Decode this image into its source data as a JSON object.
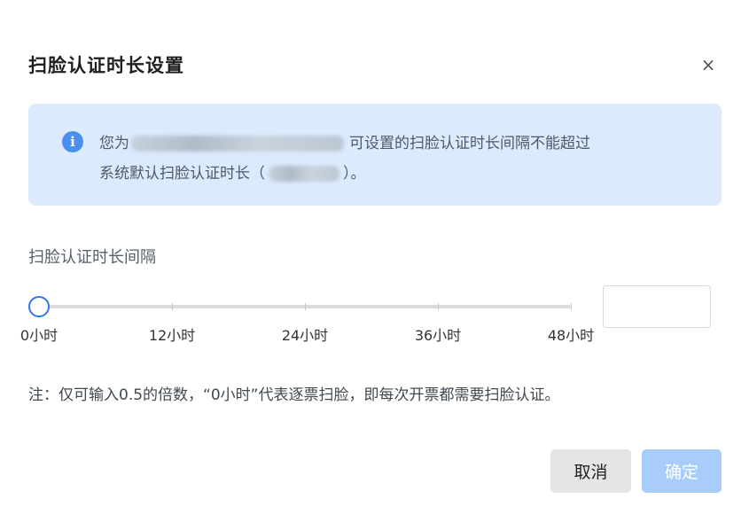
{
  "dialog": {
    "title": "扫脸认证时长设置",
    "close_label": "×",
    "notice": {
      "icon": "info-icon",
      "icon_glyph": "i",
      "line1_prefix": "您为",
      "line1_suffix": "可设置的扫脸认证时长间隔不能超过",
      "line2_prefix": "系统默认扫脸认证时长（",
      "line2_suffix": "）。"
    },
    "field_label": "扫脸认证时长间隔",
    "slider": {
      "min_hours": 0,
      "max_hours": 48,
      "value_hours": 0,
      "marks": [
        {
          "value": 0,
          "label": "0小时"
        },
        {
          "value": 12,
          "label": "12小时"
        },
        {
          "value": 24,
          "label": "24小时"
        },
        {
          "value": 36,
          "label": "36小时"
        },
        {
          "value": 48,
          "label": "48小时"
        }
      ]
    },
    "input": {
      "value": "",
      "placeholder": ""
    },
    "note": "注：仅可输入0.5的倍数，“0小时”代表逐票扫脸，即每次开票都需要扫脸认证。",
    "buttons": {
      "cancel": "取消",
      "confirm": "确定"
    },
    "colors": {
      "accent": "#2f77e6",
      "notice_bg": "#dbeafd",
      "confirm_disabled": "#a8cdfa"
    }
  }
}
